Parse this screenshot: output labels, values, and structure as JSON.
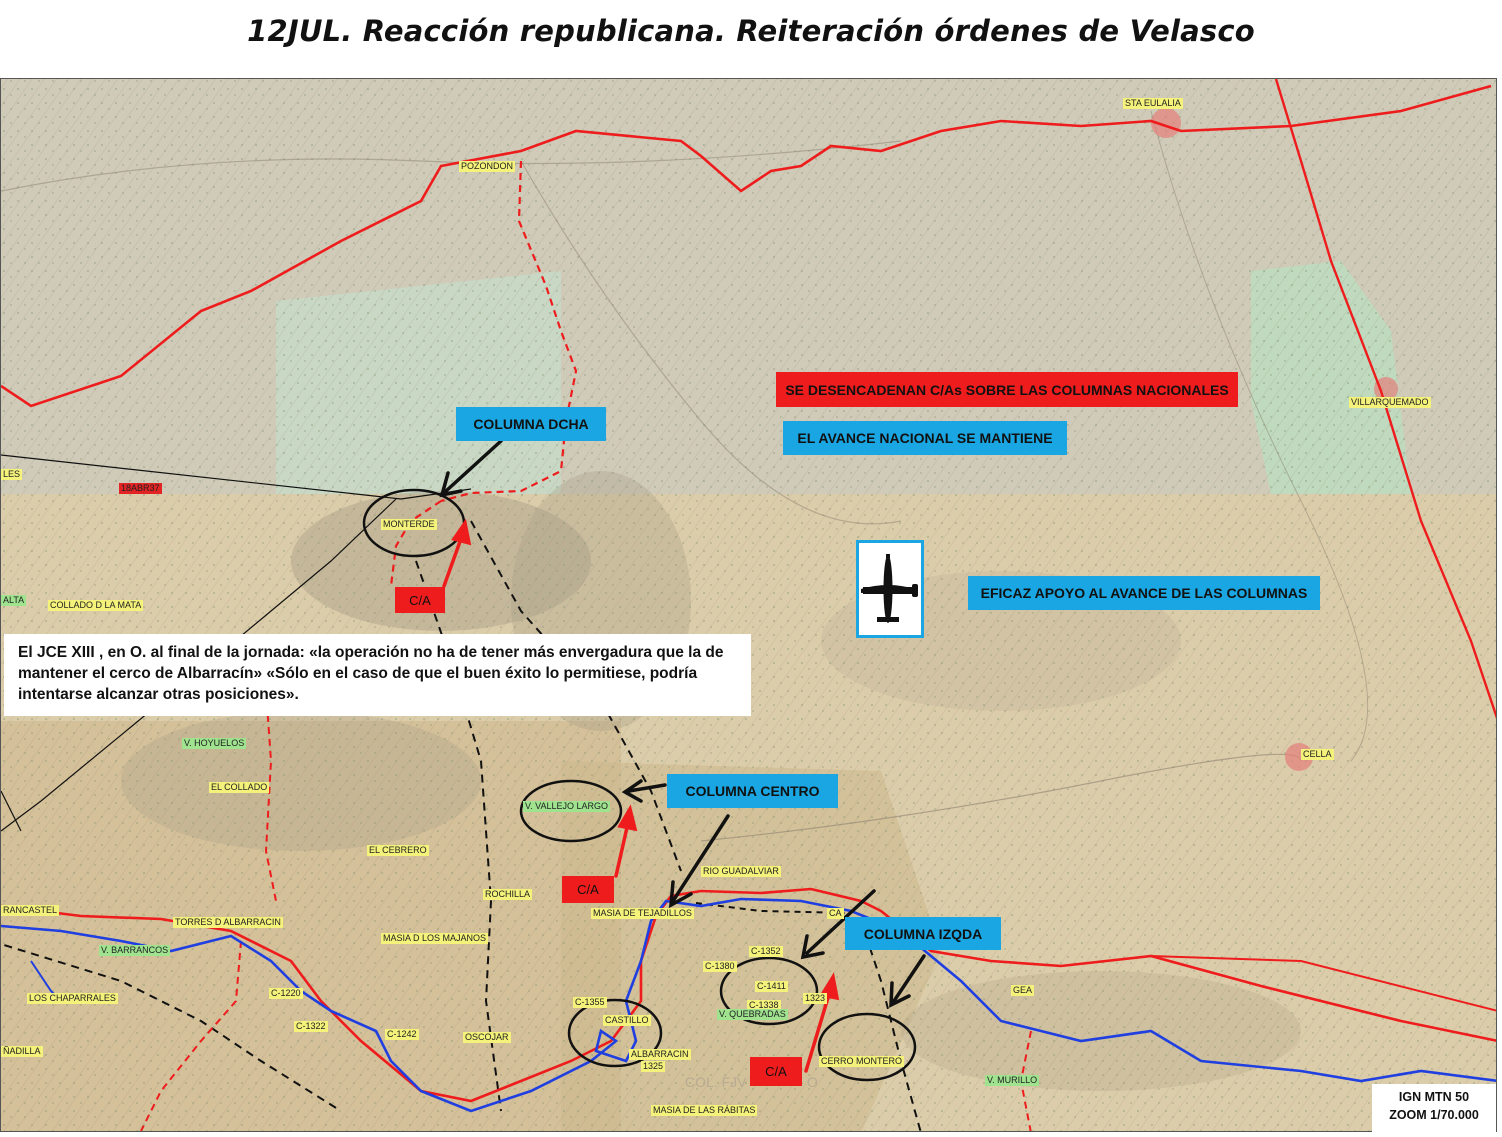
{
  "title": "12JUL.  Reacción republicana. Reiteración órdenes de Velasco",
  "colors": {
    "front_line": "#ee1c1c",
    "river": "#1f3fe0",
    "label_blue": "#1aa6e2",
    "label_red": "#ee1c1c",
    "place_yellow": "#f4f27a",
    "place_green": "#9fe38f"
  },
  "places": {
    "sta_eulalia": "STA EULALIA",
    "pozondon": "POZONDON",
    "villarquemado": "VILLARQUEMADO",
    "monterde": "MONTERDE",
    "les": "LES",
    "date_tag": "18ABR37",
    "alta": "ALTA",
    "collado_mata": "COLLADO D LA MATA",
    "cella": "CELLA",
    "v_hoyuelos": "V. HOYUELOS",
    "el_collado": "EL COLLADO",
    "v_vallejo_largo": "V. VALLEJO LARGO",
    "el_cebrero": "EL CEBRERO",
    "rio_guadalviar": "RIO GUADALVIAR",
    "rochilla": "ROCHILLA",
    "masia_tejadillos": "MASIA DE TEJADILLOS",
    "ca": "CA",
    "castel": "RANCASTEL",
    "torres_albarracin": "TORRES D ALBARRACIN",
    "masia_majanos": "MASIA D LOS MAJANOS",
    "v_barrancos": "V. BARRANCOS",
    "chaparrales": "LOS CHAPARRALES",
    "c1220": "C-1220",
    "c1322": "C-1322",
    "c1242": "C-1242",
    "nadilla": "ÑADILLA",
    "oscojar": "OSCOJAR",
    "c1352": "C-1352",
    "c1380": "C-1380",
    "c1411": "C-1411",
    "c1338": "C-1338",
    "c1323": "1323",
    "v_quebradas": "V. QUEBRADAS",
    "c1355": "C-1355",
    "castillo": "CASTILLO",
    "albarracin": "ALBARRACIN",
    "c1325": "1325",
    "cerro_montero": "CERRO MONTERO",
    "gea": "GEA",
    "v_murillo": "V. MURILLO",
    "masia_rabitas": "MASIA DE LAS RÁBITAS",
    "col_fjv": "COL. FJV",
    "faint_o": "O"
  },
  "labels": {
    "columna_dcha": "COLUMNA  DCHA",
    "columna_centro": "COLUMNA  CENTRO",
    "columna_izqda": "COLUMNA  IZQDA",
    "desencadenan": "SE DESENCADENAN C/As SOBRE LAS COLUMNAS NACIONALES",
    "avance_mantiene": "EL AVANCE NACIONAL SE MANTIENE",
    "apoyo": "EFICAZ APOYO AL AVANCE DE LAS COLUMNAS",
    "ca_1": "C/A",
    "ca_2": "C/A",
    "ca_3": "C/A"
  },
  "quote": "El JCE XIII , en O. al final de la jornada: «la operación no ha de tener más envergadura que la de mantener el cerco de Albarracín» «Sólo en el caso de que el buen éxito lo permitiese, podría intentarse alcanzar otras posiciones».",
  "scale": {
    "source": "IGN MTN 50",
    "zoom": "ZOOM 1/70.000"
  },
  "icons": {
    "aircraft": "aircraft-icon"
  }
}
